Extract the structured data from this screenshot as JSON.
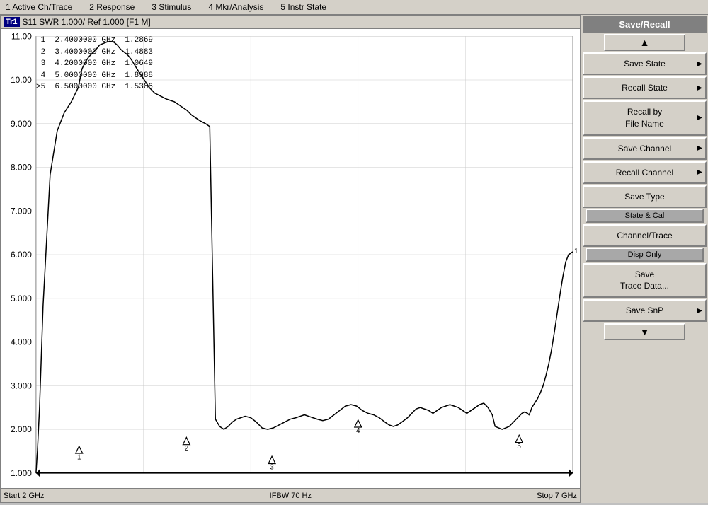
{
  "menu": {
    "items": [
      "1 Active Ch/Trace",
      "2 Response",
      "3 Stimulus",
      "4 Mkr/Analysis",
      "5 Instr State"
    ]
  },
  "trace_header": {
    "label": "Tr1",
    "info": "S11  SWR  1.000/  Ref  1.000  [F1 M]"
  },
  "markers": [
    {
      "num": "1",
      "freq": "2.4000000",
      "unit": "GHz",
      "value": "1.2869"
    },
    {
      "num": "2",
      "freq": "3.4000000",
      "unit": "GHz",
      "value": "1.4883"
    },
    {
      "num": "3",
      "freq": "4.2000000",
      "unit": "GHz",
      "value": "1.0649"
    },
    {
      "num": "4",
      "freq": "5.0000000",
      "unit": "GHz",
      "value": "1.8988"
    },
    {
      "num": ">5",
      "freq": "6.5000000",
      "unit": "GHz",
      "value": "1.5386"
    }
  ],
  "y_axis": {
    "labels": [
      "11.00",
      "10.00",
      "9.000",
      "8.000",
      "7.000",
      "6.000",
      "5.000",
      "4.000",
      "3.000",
      "2.000",
      "1.000"
    ]
  },
  "right_panel": {
    "title": "Save/Recall",
    "buttons": [
      {
        "id": "save-state",
        "label": "Save State",
        "has_arrow": true
      },
      {
        "id": "recall-state",
        "label": "Recall State",
        "has_arrow": true
      },
      {
        "id": "recall-by-file-name",
        "label": "Recall by\nFile Name",
        "has_arrow": true
      },
      {
        "id": "save-channel",
        "label": "Save Channel",
        "has_arrow": true
      },
      {
        "id": "recall-channel",
        "label": "Recall Channel",
        "has_arrow": true
      },
      {
        "id": "save-type",
        "label": "Save Type",
        "has_arrow": false,
        "sub": "State & Cal"
      },
      {
        "id": "channel-trace",
        "label": "Channel/Trace",
        "has_arrow": false,
        "sub": "Disp Only"
      },
      {
        "id": "save-trace-data",
        "label": "Save\nTrace Data...",
        "has_arrow": false
      },
      {
        "id": "save-snp",
        "label": "Save SnP",
        "has_arrow": true
      }
    ]
  },
  "status_bar": {
    "start": "Start 2 GHz",
    "center": "IFBW 70 Hz",
    "stop": "Stop 7 GHz"
  }
}
